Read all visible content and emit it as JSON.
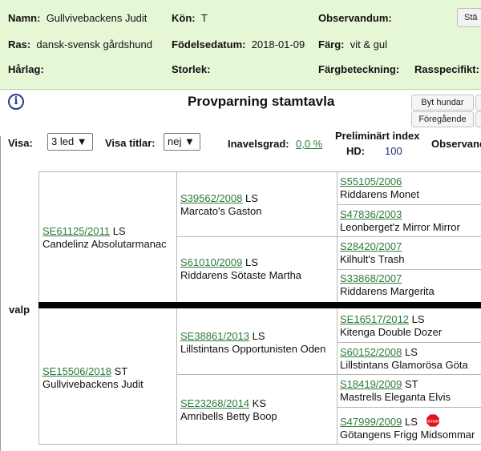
{
  "header": {
    "name_label": "Namn:",
    "name_value": "Gullvivebackens Judit",
    "sex_label": "Kön:",
    "sex_value": "T",
    "observandum_label": "Observandum:",
    "close_label": "Stä",
    "breed_label": "Ras:",
    "breed_value": "dansk-svensk gårdshund",
    "birth_label": "Födelsedatum:",
    "birth_value": "2018-01-09",
    "color_label": "Färg:",
    "color_value": "vit & gul",
    "coat_label": "Hårlag:",
    "size_label": "Storlek:",
    "marking_label": "Färgbeteckning:",
    "breedspecific_label": "Rasspecifikt:"
  },
  "title": "Provparning stamtavla",
  "buttons": {
    "switch_dogs": "Byt hundar",
    "previous": "Föregående"
  },
  "options": {
    "show_label": "Visa:",
    "show_value": "3 led ▼",
    "titles_label": "Visa titlar:",
    "titles_value": "nej ▼",
    "inbreeding_label": "Inavelsgrad:",
    "inbreeding_value": "0,0 %",
    "prelim_index_label": "Preliminärt index",
    "hd_label": "HD:",
    "hd_value": "100",
    "observando_label": "Observando"
  },
  "pedigree": {
    "puppy_label": "valp",
    "sire": {
      "reg": "SE61125/2011",
      "suffix": "LS",
      "name": "Candelinz Absolutarmanac"
    },
    "sire_sire": {
      "reg": "S39562/2008",
      "suffix": "LS",
      "name": "Marcato's Gaston"
    },
    "sire_dam": {
      "reg": "S61010/2009",
      "suffix": "LS",
      "name": "Riddarens Sötaste Martha"
    },
    "sire_sire_sire": {
      "reg": "S55105/2006",
      "suffix": "",
      "name": "Riddarens Monet"
    },
    "sire_sire_dam": {
      "reg": "S47836/2003",
      "suffix": "",
      "name": "Leonberget'z Mirror Mirror"
    },
    "sire_dam_sire": {
      "reg": "S28420/2007",
      "suffix": "",
      "name": "Kilhult's Trash"
    },
    "sire_dam_dam": {
      "reg": "S33868/2007",
      "suffix": "",
      "name": "Riddarens Margerita"
    },
    "dam": {
      "reg": "SE15506/2018",
      "suffix": "ST",
      "name": "Gullvivebackens Judit"
    },
    "dam_sire": {
      "reg": "SE38861/2013",
      "suffix": "LS",
      "name": "Lillstintans Opportunisten Oden"
    },
    "dam_dam": {
      "reg": "SE23268/2014",
      "suffix": "KS",
      "name": "Amribells Betty Boop"
    },
    "dam_sire_sire": {
      "reg": "SE16517/2012",
      "suffix": "LS",
      "name": "Kitenga Double Dozer"
    },
    "dam_sire_dam": {
      "reg": "S60152/2008",
      "suffix": "LS",
      "name": "Lillstintans Glamorösa Göta"
    },
    "dam_dam_sire": {
      "reg": "S18419/2009",
      "suffix": "ST",
      "name": "Mastrells Eleganta Elvis"
    },
    "dam_dam_dam": {
      "reg": "S47999/2009",
      "suffix": "LS",
      "name": "Götangens Frigg Midsommar"
    },
    "stop_text": "STOP"
  }
}
